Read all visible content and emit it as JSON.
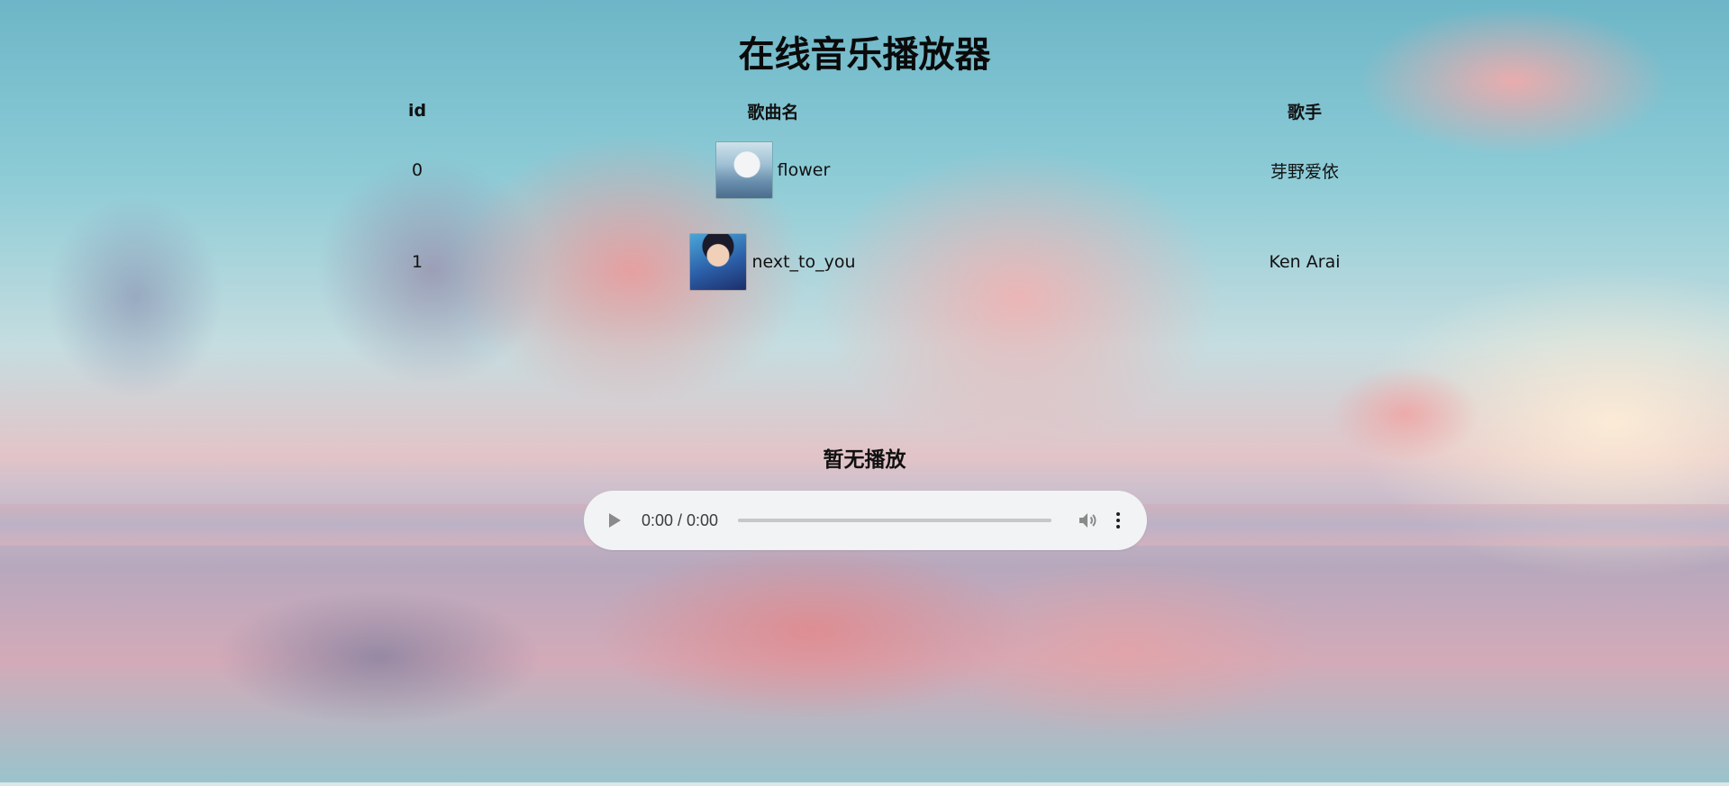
{
  "page": {
    "title": "在线音乐播放器",
    "now_playing": "暂无播放"
  },
  "table": {
    "headers": {
      "id": "id",
      "song_name": "歌曲名",
      "artist": "歌手"
    },
    "rows": [
      {
        "id": "0",
        "song_name": "flower",
        "artist": "芽野爱依",
        "cover_icon": "album-cover-anime-girl"
      },
      {
        "id": "1",
        "song_name": "next_to_you",
        "artist": "Ken Arai",
        "cover_icon": "album-cover-anime-boy"
      }
    ]
  },
  "player": {
    "time": "0:00 / 0:00",
    "progress": 0,
    "icons": {
      "play": "play-icon",
      "volume": "volume-icon",
      "menu": "more-options-icon"
    }
  }
}
